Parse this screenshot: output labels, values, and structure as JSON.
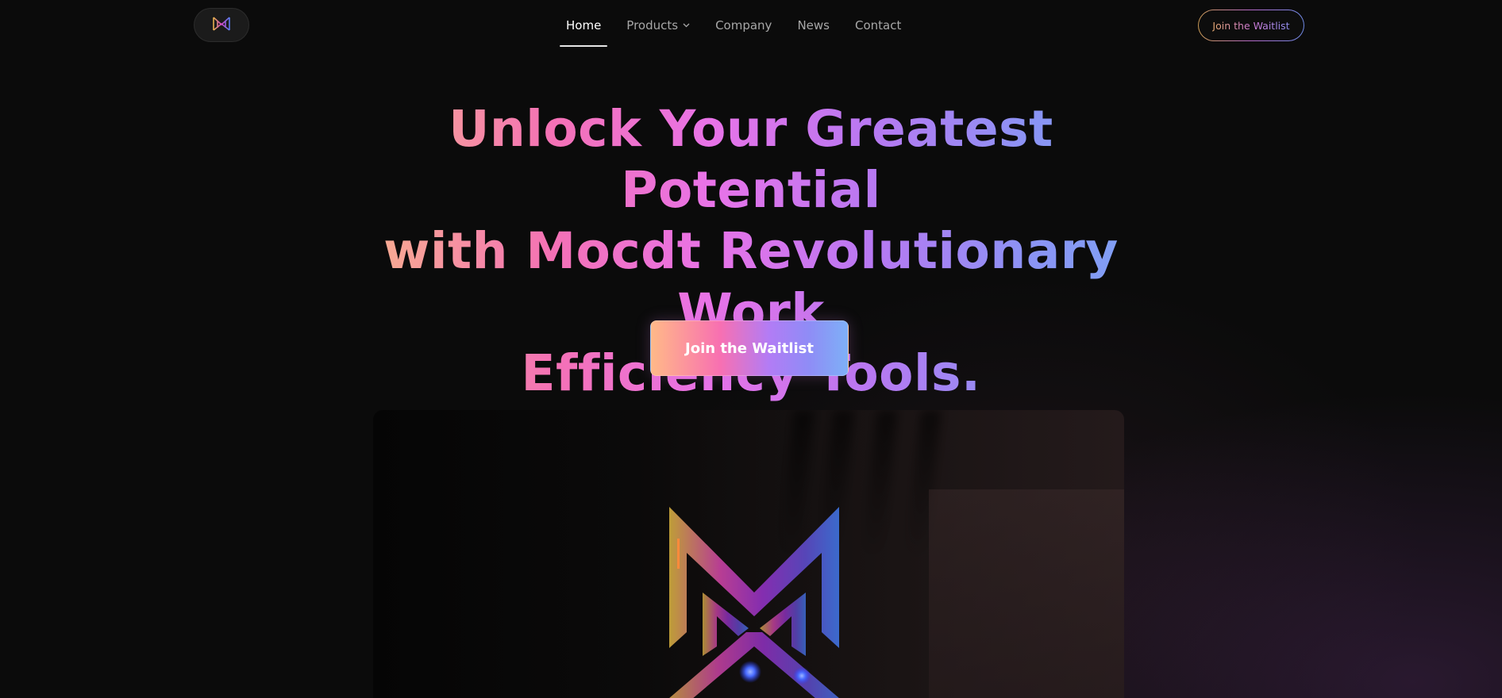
{
  "nav": {
    "logo_icon": "mocdt-m-logo-icon",
    "links": [
      {
        "label": "Home",
        "active": true
      },
      {
        "label": "Products",
        "has_dropdown": true
      },
      {
        "label": "Company"
      },
      {
        "label": "News"
      },
      {
        "label": "Contact"
      }
    ],
    "waitlist_button": "Join the Waitlist"
  },
  "hero": {
    "title_line1": "Unlock Your Greatest Potential",
    "title_line2": "with Mocdt Revolutionary Work",
    "title_line3": "Efficiency Tools.",
    "cta_label": "Join the Waitlist"
  },
  "showcase": {
    "image_icon": "mocdt-3d-m-logo-icon"
  },
  "colors": {
    "background": "#0b0b0b",
    "gradient_start": "#f8b38d",
    "gradient_mid": "#e873e8",
    "gradient_end": "#7ea3f5",
    "nav_text": "#a7a7a7",
    "nav_active": "#ffffff"
  }
}
